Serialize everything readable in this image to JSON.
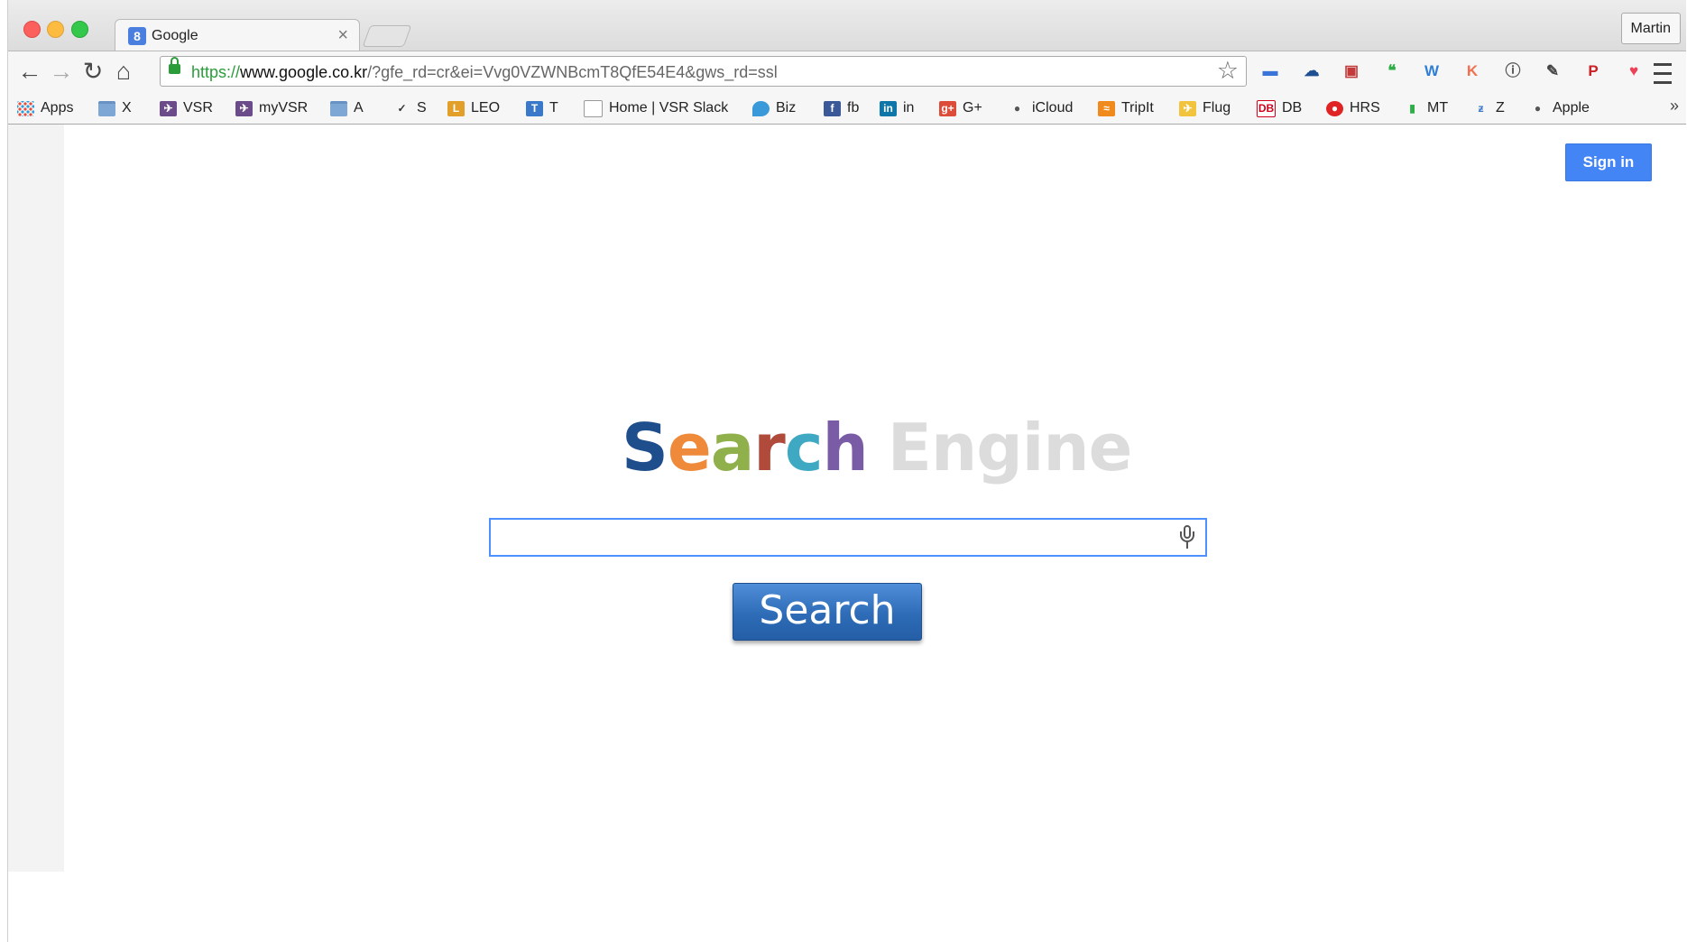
{
  "browser": {
    "tab_title": "Google",
    "tab_favicon": "8",
    "tab_close": "×",
    "profile_name": "Martin",
    "url": {
      "scheme": "https://",
      "host": "www.google.co.kr",
      "path": "/?gfe_rd=cr&ei=Vvg0VZWNBcmT8QfE54E4&gws_rd=ssl"
    },
    "nav_icons": [
      "back-arrow-icon",
      "forward-arrow-icon",
      "reload-icon",
      "home-icon"
    ],
    "extensions": [
      {
        "name": "screen-extension-icon",
        "glyph": "▬",
        "color": "#3a74d9"
      },
      {
        "name": "cloud-extension-icon",
        "glyph": "☁",
        "color": "#1d4f91"
      },
      {
        "name": "photo-extension-icon",
        "glyph": "▣",
        "color": "#c23a3a"
      },
      {
        "name": "hangouts-extension-icon",
        "glyph": "❝",
        "color": "#2fae47"
      },
      {
        "name": "word-extension-icon",
        "glyph": "W",
        "color": "#2f7fd6"
      },
      {
        "name": "k-extension-icon",
        "glyph": "K",
        "color": "#f07050"
      },
      {
        "name": "info-extension-icon",
        "glyph": "ⓘ",
        "color": "#555555"
      },
      {
        "name": "evernote-extension-icon",
        "glyph": "✎",
        "color": "#444444"
      },
      {
        "name": "pinterest-extension-icon",
        "glyph": "P",
        "color": "#cb2027"
      },
      {
        "name": "pocket-extension-icon",
        "glyph": "♥",
        "color": "#ee4056"
      }
    ]
  },
  "bookmarks": [
    {
      "label": "Apps",
      "icon": "apps-grid-icon"
    },
    {
      "label": "X",
      "icon": "folder-icon"
    },
    {
      "label": "VSR",
      "icon": "vsr-icon"
    },
    {
      "label": "myVSR",
      "icon": "vsr-icon"
    },
    {
      "label": "A",
      "icon": "folder-icon"
    },
    {
      "label": "S",
      "icon": "check-icon"
    },
    {
      "label": "LEO",
      "icon": "leo-icon"
    },
    {
      "label": "T",
      "icon": "trello-icon"
    },
    {
      "label": "Home | VSR Slack",
      "icon": "page-icon"
    },
    {
      "label": "Biz",
      "icon": "drop-icon"
    },
    {
      "label": "fb",
      "icon": "facebook-icon"
    },
    {
      "label": "in",
      "icon": "linkedin-icon"
    },
    {
      "label": "G+",
      "icon": "google-plus-icon"
    },
    {
      "label": "iCloud",
      "icon": "apple-icon"
    },
    {
      "label": "TripIt",
      "icon": "tripit-icon"
    },
    {
      "label": "Flug",
      "icon": "plane-icon"
    },
    {
      "label": "DB",
      "icon": "db-icon"
    },
    {
      "label": "HRS",
      "icon": "hrs-icon"
    },
    {
      "label": "MT",
      "icon": "mt-icon"
    },
    {
      "label": "Z",
      "icon": "z-icon"
    },
    {
      "label": "Apple",
      "icon": "apple-icon"
    }
  ],
  "bookmarks_more": "»",
  "page": {
    "signin_label": "Sign in",
    "logo_word1_letters": [
      {
        "ch": "S",
        "color": "#1f4e8c"
      },
      {
        "ch": "e",
        "color": "#ef8a3a"
      },
      {
        "ch": "a",
        "color": "#8fb04a"
      },
      {
        "ch": "r",
        "color": "#b04a3a"
      },
      {
        "ch": "c",
        "color": "#3fa9c4"
      },
      {
        "ch": "h",
        "color": "#7a5ba6"
      }
    ],
    "logo_word2": "Engine",
    "search_value": "",
    "search_button_label": "Search"
  },
  "colors": {
    "accent": "#4485f5",
    "search_button": "#2e6cb7",
    "url_green": "#2a9d3a"
  }
}
